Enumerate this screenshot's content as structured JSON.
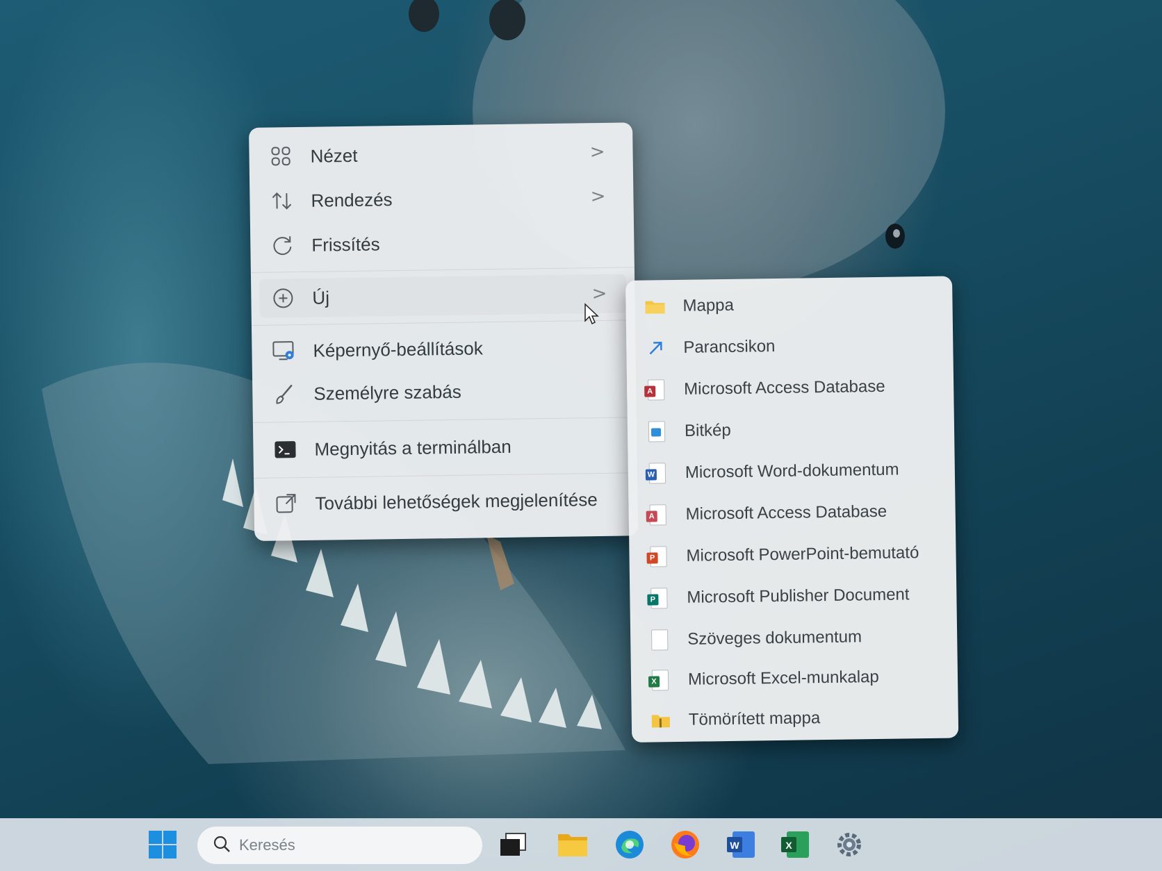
{
  "context_menu": {
    "items": [
      {
        "label": "Nézet",
        "icon": "grid-icon",
        "has_submenu": true
      },
      {
        "label": "Rendezés",
        "icon": "sort-icon",
        "has_submenu": true
      },
      {
        "label": "Frissítés",
        "icon": "refresh-icon",
        "has_submenu": false
      },
      {
        "label": "Új",
        "icon": "new-plus-icon",
        "has_submenu": true
      },
      {
        "label": "Képernyő-beállítások",
        "icon": "display-settings-icon",
        "has_submenu": false
      },
      {
        "label": "Személyre szabás",
        "icon": "brush-icon",
        "has_submenu": false
      },
      {
        "label": "Megnyitás a terminálban",
        "icon": "terminal-icon",
        "has_submenu": false
      },
      {
        "label": "További lehetőségek megjelenítése",
        "icon": "more-options-icon",
        "has_submenu": false
      }
    ],
    "submenu_arrow": ">"
  },
  "new_submenu": {
    "items": [
      {
        "label": "Mappa",
        "icon": "folder-icon"
      },
      {
        "label": "Parancsikon",
        "icon": "shortcut-icon"
      },
      {
        "label": "Microsoft Access Database",
        "icon": "access-icon"
      },
      {
        "label": "Bitkép",
        "icon": "bitmap-icon"
      },
      {
        "label": "Microsoft Word-dokumentum",
        "icon": "word-doc-icon"
      },
      {
        "label": "Microsoft Access Database",
        "icon": "access-icon"
      },
      {
        "label": "Microsoft PowerPoint-bemutató",
        "icon": "powerpoint-icon"
      },
      {
        "label": "Microsoft Publisher Document",
        "icon": "publisher-icon"
      },
      {
        "label": "Szöveges dokumentum",
        "icon": "text-doc-icon"
      },
      {
        "label": "Microsoft Excel-munkalap",
        "icon": "excel-icon"
      },
      {
        "label": "Tömörített mappa",
        "icon": "zip-folder-icon"
      }
    ]
  },
  "taskbar": {
    "search_placeholder": "Keresés",
    "apps": [
      "start-icon",
      "task-view-icon",
      "file-explorer-icon",
      "edge-icon",
      "firefox-icon",
      "word-icon",
      "excel-icon",
      "settings-icon"
    ]
  },
  "colors": {
    "menu_bg": "#eceef0",
    "folder": "#f4c542",
    "word": "#2b5fb4",
    "excel": "#1f7a45",
    "access": "#b7313a",
    "powerpoint": "#d24726",
    "publisher": "#077568"
  }
}
